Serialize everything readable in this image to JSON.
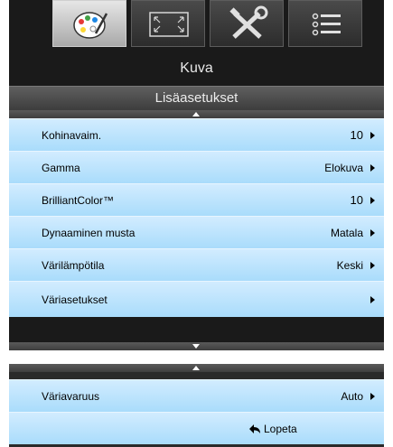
{
  "tabs": [
    {
      "icon": "palette-icon",
      "active": true
    },
    {
      "icon": "screen-icon",
      "active": false
    },
    {
      "icon": "tools-icon",
      "active": false
    },
    {
      "icon": "list-icon",
      "active": false
    }
  ],
  "header": {
    "title": "Kuva",
    "subtitle": "Lisäasetukset"
  },
  "menu": [
    {
      "label": "Kohinavaim.",
      "value": "10"
    },
    {
      "label": "Gamma",
      "value": "Elokuva"
    },
    {
      "label": "BrilliantColor™",
      "value": "10"
    },
    {
      "label": "Dynaaminen musta",
      "value": "Matala"
    },
    {
      "label": "Värilämpötila",
      "value": "Keski"
    },
    {
      "label": "Väriasetukset",
      "value": ""
    }
  ],
  "bottom": {
    "rows": [
      {
        "label": "Väriavaruus",
        "value": "Auto"
      }
    ],
    "exit_label": "Lopeta"
  },
  "colors": {
    "row_top": "#d2ecff",
    "row_bottom": "#a9dcfb",
    "panel": "#1a1a1a"
  }
}
